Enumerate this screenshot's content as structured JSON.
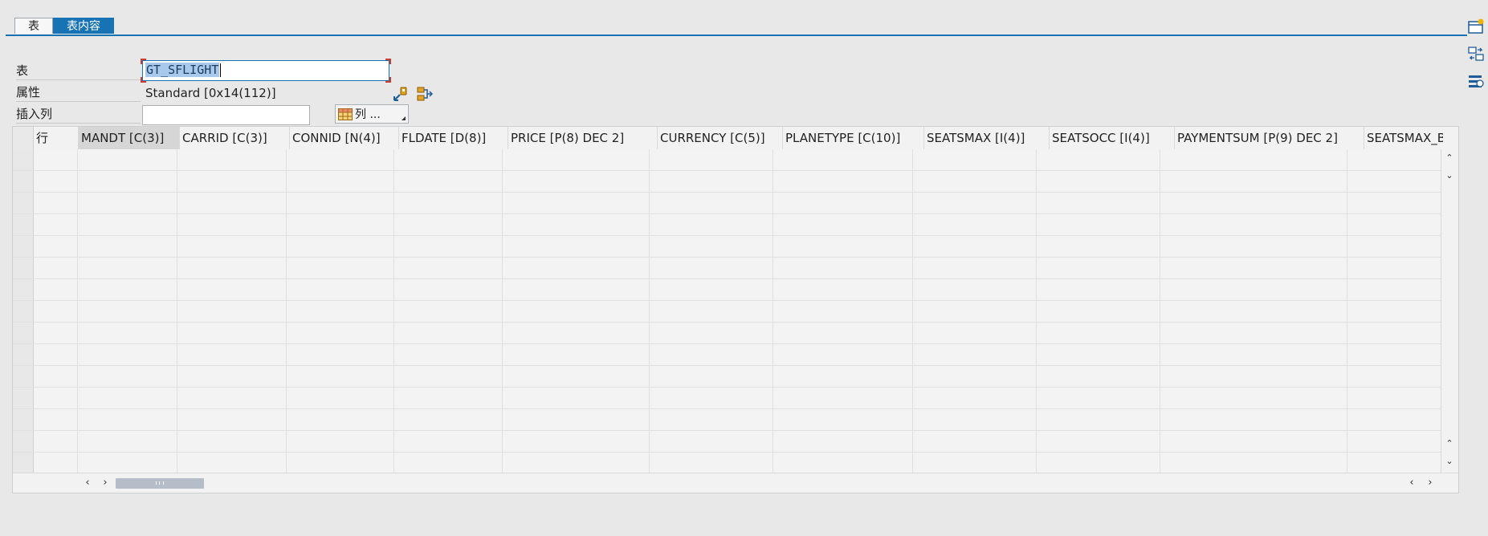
{
  "tabs": [
    {
      "label": "表",
      "active": false
    },
    {
      "label": "表内容",
      "active": true
    }
  ],
  "form": {
    "table_label": "表",
    "table_value_selected": "GT_SFLIGHT",
    "attr_label": "属性",
    "attr_value": "Standard [0x14(112)]",
    "insert_label": "插入列",
    "insert_value": "",
    "column_button": "列 ..."
  },
  "grid": {
    "columns": [
      "行",
      "MANDT [C(3)]",
      "CARRID [C(3)]",
      "CONNID [N(4)]",
      "FLDATE [D(8)]",
      "PRICE [P(8) DEC 2]",
      "CURRENCY [C(5)]",
      "PLANETYPE [C(10)]",
      "SEATSMAX [I(4)]",
      "SEATSOCC [I(4)]",
      "PAYMENTSUM [P(9) DEC 2]",
      "SEATSMAX_B"
    ]
  },
  "icons": {
    "right": [
      "new-table-icon",
      "swap-icon",
      "settings-icon"
    ],
    "attr": [
      "detail-icon",
      "structure-icon"
    ],
    "scroll": [
      "chevron-up-icon",
      "chevron-down-icon",
      "chevron-left-icon",
      "chevron-right-icon"
    ]
  },
  "colors": {
    "accent": "#1873b4",
    "selection": "#a9c9ec",
    "focus_corner": "#d23a2a"
  }
}
